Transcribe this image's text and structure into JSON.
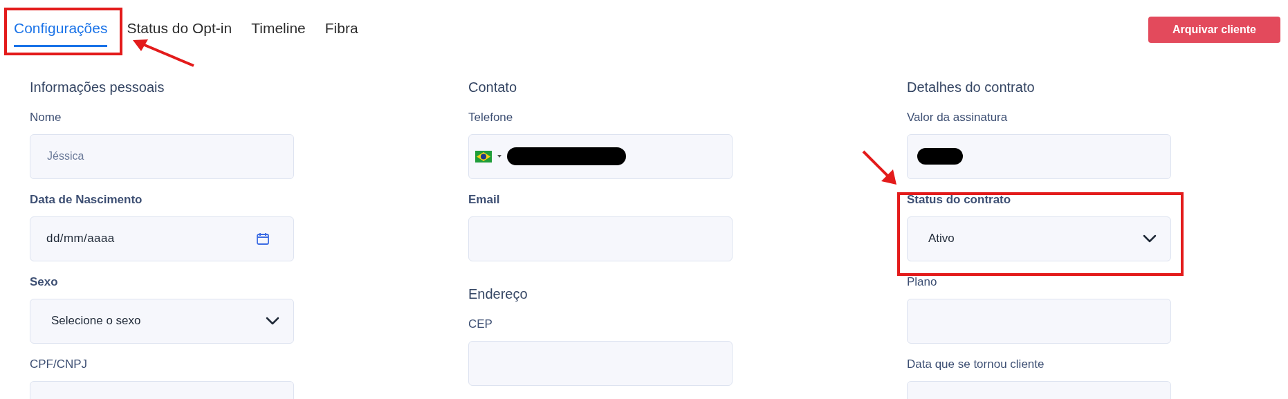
{
  "tabs": [
    {
      "label": "Configurações",
      "selected": true
    },
    {
      "label": "Status do Opt-in",
      "selected": false
    },
    {
      "label": "Timeline",
      "selected": false
    },
    {
      "label": "Fibra",
      "selected": false
    }
  ],
  "archive_button": {
    "label": "Arquivar cliente"
  },
  "columns": [
    {
      "sections": [
        {
          "title": "Informações pessoais",
          "fields": [
            {
              "label": "Nome",
              "emphasized": false,
              "kind": "text",
              "value": "Jéssica"
            },
            {
              "label": "Data de Nascimento",
              "emphasized": true,
              "kind": "date",
              "value": "dd/mm/aaaa"
            },
            {
              "label": "Sexo",
              "emphasized": true,
              "kind": "select",
              "value": "Selecione o sexo"
            },
            {
              "label": "CPF/CNPJ",
              "emphasized": false,
              "kind": "text"
            }
          ]
        }
      ]
    },
    {
      "sections": [
        {
          "title": "Contato",
          "fields": [
            {
              "label": "Telefone",
              "emphasized": false,
              "kind": "phone",
              "redacted": true
            },
            {
              "label": "Email",
              "emphasized": true,
              "kind": "text"
            }
          ]
        },
        {
          "title": "Endereço",
          "fields": [
            {
              "label": "CEP",
              "emphasized": false,
              "kind": "text"
            }
          ]
        }
      ]
    },
    {
      "sections": [
        {
          "title": "Detalhes do contrato",
          "fields": [
            {
              "label": "Valor da assinatura",
              "emphasized": false,
              "kind": "text",
              "redacted": true
            },
            {
              "label": "Status do contrato",
              "emphasized": true,
              "kind": "select",
              "value": "Ativo"
            },
            {
              "label": "Plano",
              "emphasized": false,
              "kind": "text"
            },
            {
              "label": "Data que se tornou cliente",
              "emphasized": false,
              "kind": "text"
            }
          ]
        }
      ]
    }
  ]
}
